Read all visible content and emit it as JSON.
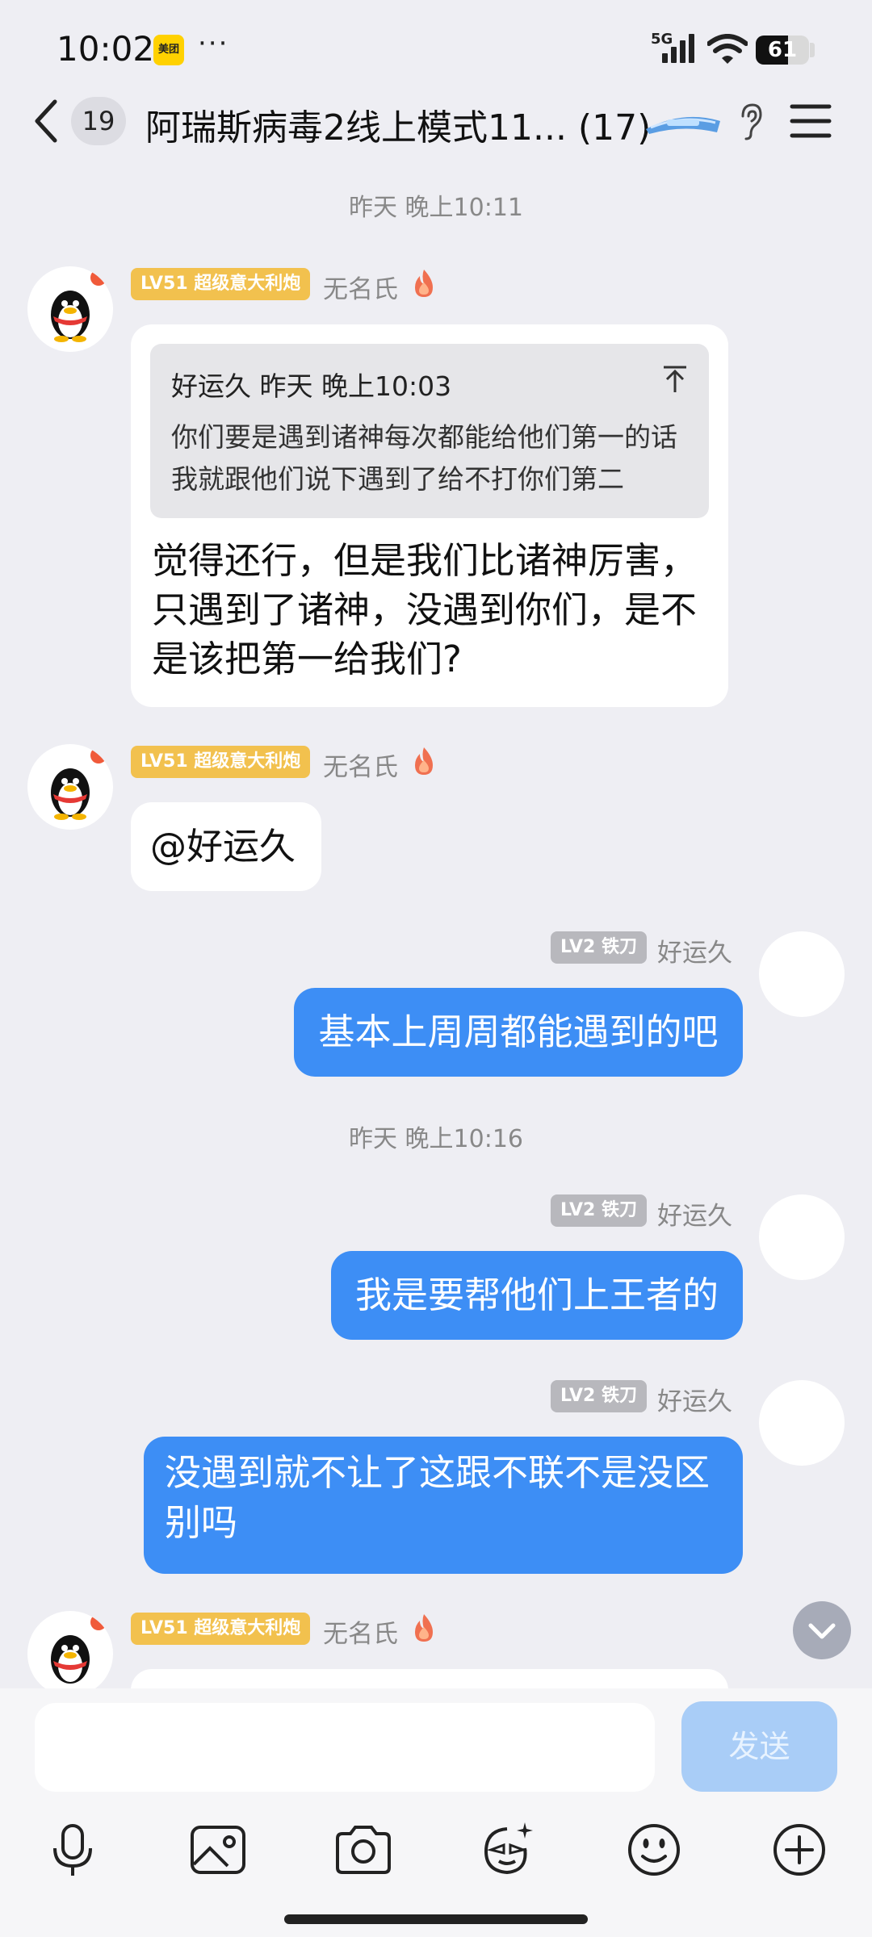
{
  "status_bar": {
    "time": "10:02",
    "app_badge": "美团",
    "more": "···",
    "network": "5G",
    "battery": "61",
    "battery_level_percent": 61
  },
  "header": {
    "unread_count": "19",
    "title": "阿瑞斯病毒2线上模式11... (17)"
  },
  "timestamps": [
    "昨天 晚上10:11",
    "昨天 晚上10:16"
  ],
  "messages": [
    {
      "sender_level": "LV51 超级意大利炮",
      "sender_name": "无名氏",
      "quote": {
        "header": "好运久 昨天 晚上10:03",
        "text": "你们要是遇到诸神每次都能给他们第一的话我就跟他们说下遇到了给不打你们第二"
      },
      "lines": [
        "觉得还行，但是我们比诸神厉害，",
        "只遇到了诸神，没遇到你们，是不",
        "是该把第一给我们?"
      ]
    },
    {
      "sender_level": "LV51 超级意大利炮",
      "sender_name": "无名氏",
      "text": "@好运久"
    },
    {
      "sender_level": "LV2 铁刀",
      "sender_name": "好运久",
      "text": "基本上周周都能遇到的吧"
    },
    {
      "sender_level": "LV2 铁刀",
      "sender_name": "好运久",
      "text": "我是要帮他们上王者的"
    },
    {
      "sender_level": "LV2 铁刀",
      "sender_name": "好运久",
      "lines": [
        "没遇到就不让了这跟不联不是没区",
        "别吗"
      ]
    },
    {
      "sender_level": "LV51 超级意大利炮",
      "sender_name": "无名氏"
    }
  ],
  "input": {
    "placeholder": "",
    "send_label": "发送"
  },
  "toolbar": [
    "mic-icon",
    "image-icon",
    "camera-icon",
    "face-effect-icon",
    "emoji-icon",
    "plus-icon"
  ]
}
